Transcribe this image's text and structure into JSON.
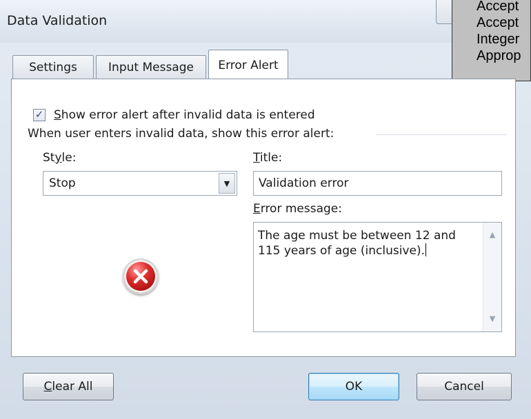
{
  "window": {
    "title": "Data Validation"
  },
  "callout": {
    "lines": [
      "Accept",
      "Accept",
      "Integer",
      "Approp"
    ]
  },
  "tabs": [
    {
      "label": "Settings"
    },
    {
      "label": "Input Message"
    },
    {
      "label": "Error Alert",
      "active": true
    }
  ],
  "show_alert": {
    "checked": true,
    "label_access": "S",
    "label_rest": "how error alert after invalid data is entered"
  },
  "group_caption": "When user enters invalid data, show this error alert:",
  "style": {
    "label_pre": "St",
    "label_access": "y",
    "label_post": "le:",
    "value": "Stop"
  },
  "title_field": {
    "label_access": "T",
    "label_rest": "itle:",
    "value": "Validation error"
  },
  "error_message": {
    "label_access": "E",
    "label_rest": "rror message:",
    "value": "The age must be between 12 and 115 years of age (inclusive)."
  },
  "icons": {
    "alert": "error-stop-icon",
    "checkbox_mark": "checkmark-icon",
    "dropdown": "chevron-down-icon"
  },
  "buttons": {
    "clear_all_access": "C",
    "clear_all_rest": "lear All",
    "ok": "OK",
    "cancel": "Cancel"
  },
  "colors": {
    "default_button": "#bee6fd",
    "error_icon": "#e03030",
    "callout_bg": "#c0c0c0"
  }
}
